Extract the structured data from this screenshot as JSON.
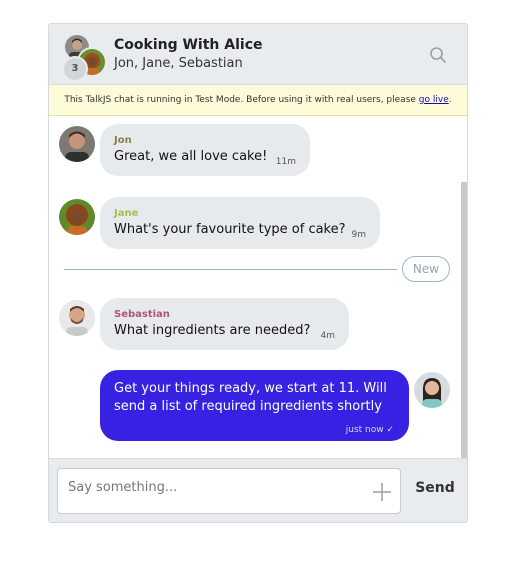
{
  "header": {
    "title": "Cooking With Alice",
    "participants": "Jon, Jane, Sebastian",
    "participant_count": "3"
  },
  "test_mode": {
    "message": "This TalkJS chat is running in Test Mode. Before using it with real users, please",
    "link_label": "go live",
    "period": "."
  },
  "messages": [
    {
      "sender": "Jon",
      "sender_color": "#8a7f4a",
      "text": "Great, we all love cake!",
      "time": "11m"
    },
    {
      "sender": "Jane",
      "sender_color": "#a2c14a",
      "text": "What's your favourite type of cake?",
      "time": "9m"
    },
    {
      "sender": "Sebastian",
      "sender_color": "#b0557a",
      "text": "What ingredients are needed?",
      "time": "4m"
    }
  ],
  "divider": {
    "label": "New"
  },
  "own_message": {
    "text": "Get your things ready, we start at 11. Will send a list of required ingredients shortly",
    "time": "just now ✓"
  },
  "composer": {
    "placeholder": "Say something...",
    "send_label": "Send"
  },
  "icons": {
    "search": "search-icon",
    "attach": "plus-icon"
  },
  "colors": {
    "own_bubble": "#3721e3",
    "other_bubble": "#e7eaed",
    "test_bar": "#fdfbd8"
  }
}
